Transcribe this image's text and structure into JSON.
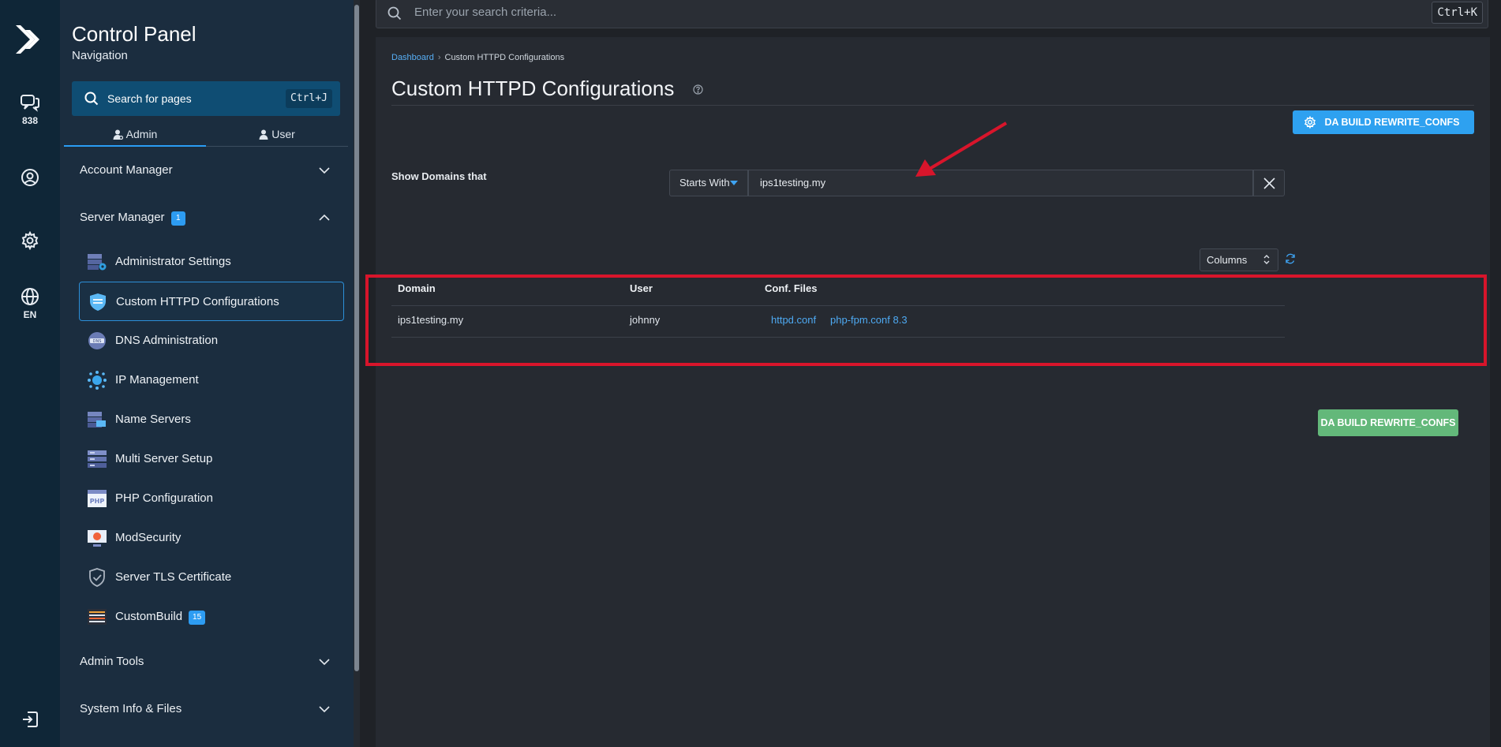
{
  "rail": {
    "messages_count": "838",
    "language": "EN"
  },
  "nav": {
    "title": "Control Panel",
    "subtitle": "Navigation",
    "search_label": "Search for pages",
    "search_shortcut": "Ctrl+J",
    "tabs": [
      {
        "label": "Admin",
        "active": true
      },
      {
        "label": "User",
        "active": false
      }
    ],
    "sections": {
      "account_manager": "Account Manager",
      "server_manager": "Server Manager",
      "server_manager_badge": "1",
      "admin_tools": "Admin Tools",
      "system_info": "System Info & Files"
    },
    "items": [
      {
        "label": "Administrator Settings",
        "icon": "admin-settings-icon"
      },
      {
        "label": "Custom HTTPD Configurations",
        "icon": "shield-config-icon",
        "active": true
      },
      {
        "label": "DNS Administration",
        "icon": "dns-icon"
      },
      {
        "label": "IP Management",
        "icon": "ip-network-icon"
      },
      {
        "label": "Name Servers",
        "icon": "name-servers-icon"
      },
      {
        "label": "Multi Server Setup",
        "icon": "multi-server-icon"
      },
      {
        "label": "PHP Configuration",
        "icon": "php-icon"
      },
      {
        "label": "ModSecurity",
        "icon": "modsecurity-icon"
      },
      {
        "label": "Server TLS Certificate",
        "icon": "tls-shield-icon"
      },
      {
        "label": "CustomBuild",
        "icon": "custombuild-icon",
        "badge": "15"
      }
    ]
  },
  "top_search": {
    "placeholder": "Enter your search criteria...",
    "shortcut": "Ctrl+K"
  },
  "breadcrumb": {
    "root": "Dashboard",
    "current": "Custom HTTPD Configurations"
  },
  "page": {
    "title": "Custom HTTPD Configurations",
    "build_button": "DA BUILD REWRITE_CONFS",
    "build_button_bottom": "DA BUILD REWRITE_CONFS"
  },
  "filter": {
    "label": "Show Domains that",
    "mode": "Starts With",
    "value": "ips1testing.my"
  },
  "table": {
    "columns_button": "Columns",
    "headers": [
      "Domain",
      "User",
      "Conf. Files"
    ],
    "rows": [
      {
        "domain": "ips1testing.my",
        "user": "johnny",
        "files": [
          "httpd.conf",
          "php-fpm.conf 8.3"
        ]
      }
    ]
  },
  "colors": {
    "accent_blue": "#2ea1f0",
    "success_green": "#63b87a",
    "highlight_red": "#d8152b"
  }
}
